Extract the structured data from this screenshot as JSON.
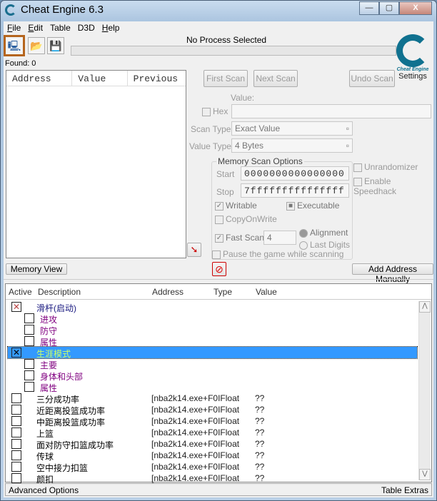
{
  "window": {
    "title": "Cheat Engine 6.3",
    "min": "—",
    "max": "▢",
    "close": "X"
  },
  "menu": [
    {
      "label": "File",
      "u": "F",
      "rest": "ile"
    },
    {
      "label": "Edit",
      "u": "E",
      "rest": "dit"
    },
    {
      "label": "Table",
      "u": "",
      "rest": "Table"
    },
    {
      "label": "D3D",
      "u": "",
      "rest": "D3D"
    },
    {
      "label": "Help",
      "u": "H",
      "rest": "elp"
    }
  ],
  "process": "No Process Selected",
  "found": "Found: 0",
  "logo": {
    "brand": "Cheat Engine",
    "settings": "Settings"
  },
  "scan_list": {
    "columns": [
      "Address",
      "Value",
      "Previous"
    ]
  },
  "buttons": {
    "first_scan": "First Scan",
    "next_scan": "Next Scan",
    "undo_scan": "Undo Scan",
    "memory_view": "Memory View",
    "add_address": "Add Address Manually"
  },
  "scan": {
    "value_label": "Value:",
    "hex": "Hex",
    "scan_type_label": "Scan Type",
    "scan_type": "Exact Value",
    "value_type_label": "Value Type",
    "value_type": "4 Bytes"
  },
  "memory": {
    "caption": "Memory Scan Options",
    "start_label": "Start",
    "start": "0000000000000000",
    "stop_label": "Stop",
    "stop": "7fffffffffffffff",
    "writable": "Writable",
    "executable": "Executable",
    "copyonwrite": "CopyOnWrite",
    "fast_scan": "Fast Scan",
    "fast_value": "4",
    "alignment": "Alignment",
    "last_digits": "Last Digits",
    "pause": "Pause the game while scanning"
  },
  "options": {
    "unrandomizer": "Unrandomizer",
    "speedhack": "Enable Speedhack"
  },
  "table": {
    "columns": [
      "Active",
      "Description",
      "Address",
      "Type",
      "Value"
    ],
    "rows": [
      {
        "desc": "滑杆(启动)",
        "level": 0,
        "checked": true,
        "color": "#1a1a80",
        "addr": "",
        "val": ""
      },
      {
        "desc": "进攻",
        "level": 1,
        "checked": false,
        "color": "#800080",
        "addr": "",
        "val": ""
      },
      {
        "desc": "防守",
        "level": 1,
        "checked": false,
        "color": "#800080",
        "addr": "",
        "val": ""
      },
      {
        "desc": "属性",
        "level": 1,
        "checked": false,
        "color": "#800080",
        "addr": "",
        "val": ""
      },
      {
        "desc": "生涯模式",
        "level": 0,
        "checked": true,
        "selected": true,
        "color": "#ccff66",
        "addr": "",
        "val": ""
      },
      {
        "desc": "主要",
        "level": 1,
        "checked": false,
        "color": "#800080",
        "addr": "",
        "val": ""
      },
      {
        "desc": "身体和头部",
        "level": 1,
        "checked": false,
        "color": "#800080",
        "addr": "",
        "val": ""
      },
      {
        "desc": "属性",
        "level": 1,
        "checked": false,
        "color": "#800080",
        "addr": "",
        "val": ""
      },
      {
        "desc": "三分成功率",
        "level": 0,
        "checked": false,
        "color": "#000",
        "addr": "[nba2k14.exe+F0IFloat",
        "val": "??"
      },
      {
        "desc": "近距离投篮成功率",
        "level": 0,
        "checked": false,
        "color": "#000",
        "addr": "[nba2k14.exe+F0IFloat",
        "val": "??"
      },
      {
        "desc": "中距离投篮成功率",
        "level": 0,
        "checked": false,
        "color": "#000",
        "addr": "[nba2k14.exe+F0IFloat",
        "val": "??"
      },
      {
        "desc": "上篮",
        "level": 0,
        "checked": false,
        "color": "#000",
        "addr": "[nba2k14.exe+F0IFloat",
        "val": "??"
      },
      {
        "desc": "面对防守扣篮成功率",
        "level": 0,
        "checked": false,
        "color": "#000",
        "addr": "[nba2k14.exe+F0IFloat",
        "val": "??"
      },
      {
        "desc": "传球",
        "level": 0,
        "checked": false,
        "color": "#000",
        "addr": "[nba2k14.exe+F0IFloat",
        "val": "??"
      },
      {
        "desc": "空中接力扣篮",
        "level": 0,
        "checked": false,
        "color": "#000",
        "addr": "[nba2k14.exe+F0IFloat",
        "val": "??"
      },
      {
        "desc": "颜扣",
        "level": 0,
        "checked": false,
        "color": "#000",
        "addr": "[nba2k14.exe+F0IFloat",
        "val": "??"
      }
    ]
  },
  "bottom": {
    "advanced": "Advanced Options",
    "extras": "Table Extras"
  }
}
